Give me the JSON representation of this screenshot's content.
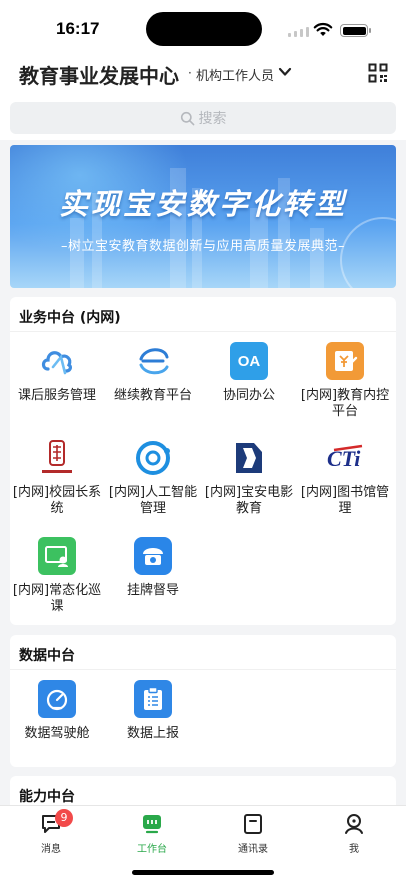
{
  "status": {
    "time": "16:17"
  },
  "header": {
    "title": "教育事业发展中心",
    "dot": "·",
    "role": "机构工作人员"
  },
  "search": {
    "placeholder": "搜索"
  },
  "banner": {
    "title": "实现宝安数字化转型",
    "subtitle": "–树立宝安教育数据创新与应用高质量发展典范–"
  },
  "sections": [
    {
      "title": "业务中台 (内网)",
      "items": [
        {
          "label": "课后服务管理",
          "icon": "cloud-icon"
        },
        {
          "label": "继续教育平台",
          "icon": "continuing-education-icon"
        },
        {
          "label": "协同办公",
          "icon": "oa-icon"
        },
        {
          "label": "[内网]教育内控平台",
          "icon": "finance-control-icon"
        },
        {
          "label": "[内网]校园长系统",
          "icon": "principal-seal-icon"
        },
        {
          "label": "[内网]人工智能管理",
          "icon": "ai-ring-icon"
        },
        {
          "label": "[内网]宝安电影教育",
          "icon": "film-education-icon"
        },
        {
          "label": "[内网]图书馆管理",
          "icon": "library-cti-icon"
        },
        {
          "label": "[内网]常态化巡课",
          "icon": "patrol-class-icon"
        },
        {
          "label": "挂牌督导",
          "icon": "supervision-icon"
        }
      ]
    },
    {
      "title": "数据中台",
      "items": [
        {
          "label": "数据驾驶舱",
          "icon": "dashboard-gauge-icon"
        },
        {
          "label": "数据上报",
          "icon": "report-clipboard-icon"
        }
      ]
    },
    {
      "title": "能力中台",
      "items": []
    }
  ],
  "tabs": [
    {
      "label": "消息",
      "badge": "9",
      "icon": "message-icon"
    },
    {
      "label": "工作台",
      "icon": "workbench-icon"
    },
    {
      "label": "通讯录",
      "icon": "contacts-icon"
    },
    {
      "label": "我",
      "icon": "profile-icon"
    }
  ],
  "colors": {
    "accent": "#2aa84a",
    "badge": "#f24a4a",
    "banner": "#4a8fe6"
  }
}
